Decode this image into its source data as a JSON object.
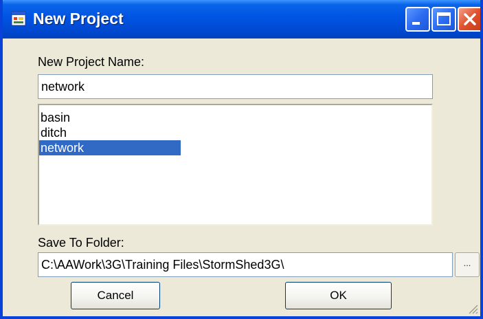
{
  "window": {
    "title": "New Project"
  },
  "form": {
    "name_label": "New Project Name:",
    "name_value": "network",
    "folder_label": "Save To Folder:",
    "folder_value": "C:\\AAWork\\3G\\Training Files\\StormShed3G\\",
    "browse_label": "...",
    "cancel_label": "Cancel",
    "ok_label": "OK"
  },
  "projects": {
    "items": [
      {
        "label": "basin",
        "selected": false
      },
      {
        "label": "ditch",
        "selected": false
      },
      {
        "label": "network",
        "selected": true
      }
    ]
  },
  "colors": {
    "titlebar": "#0054e3",
    "selection": "#316ac5",
    "dialog_bg": "#ece9d8"
  }
}
